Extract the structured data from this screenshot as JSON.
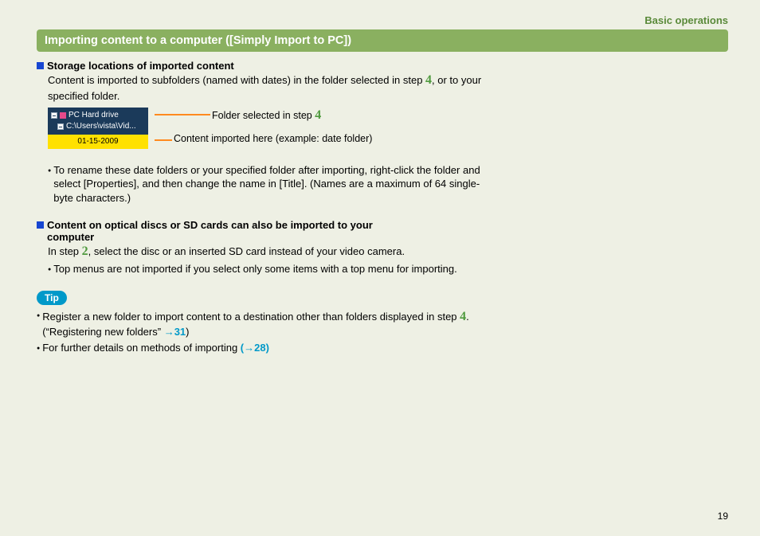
{
  "header": {
    "section": "Basic operations"
  },
  "titleBar": "Importing content to a computer ([Simply Import to PC])",
  "sec1": {
    "heading": "Storage locations of imported content",
    "para_a": "Content is imported to subfolders (named with dates) in the folder selected in step ",
    "step1": "4",
    "para_b": ", or to your specified folder."
  },
  "shot": {
    "row1": "PC Hard drive",
    "row2": "C:\\Users\\vista\\Vid...",
    "row3": "01-15-2009"
  },
  "callout1_a": "Folder selected in step ",
  "callout1_step": "4",
  "callout2": "Content imported here (example: date folder)",
  "note1": "To rename these date folders or your specified folder after importing, right-click the folder and select [Properties], and then change the name in [Title]. (Names are a maximum of 64 single-byte characters.)",
  "sec2": {
    "heading": "Content on optical discs or SD cards can also be imported to your computer",
    "para_a": "In step ",
    "step": "2",
    "para_b": ", select the disc or an inserted SD card instead of your video camera.",
    "note": "Top menus are not imported if you select only some items with a top menu for importing."
  },
  "tip": {
    "label": "Tip",
    "b1_a": "Register a new folder to import content to a destination other than folders displayed in step ",
    "b1_step": "4",
    "b1_b": ". (“Registering new folders” ",
    "b1_link": "→31",
    "b1_c": ")",
    "b2_a": "For further details on methods of importing ",
    "b2_link": "(→28)"
  },
  "pageNumber": "19"
}
